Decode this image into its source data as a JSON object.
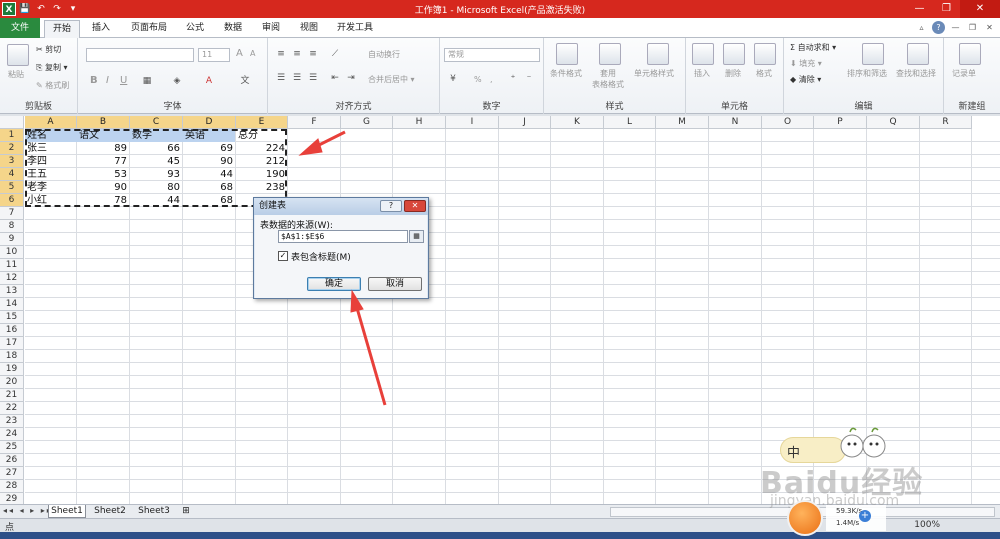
{
  "window": {
    "title": "工作簿1 - Microsoft Excel(产品激活失败)",
    "quick_access": [
      "X",
      "💾",
      "↶",
      "↷",
      "▾"
    ],
    "controls": [
      "—",
      "❐",
      "✕"
    ]
  },
  "tabs": [
    "文件",
    "开始",
    "插入",
    "页面布局",
    "公式",
    "数据",
    "审阅",
    "视图",
    "开发工具"
  ],
  "ribbon": {
    "clipboard": {
      "paste": "粘贴",
      "cut": "剪切",
      "copy": "复制 ▾",
      "format_painter": "格式刷",
      "label": "剪贴板"
    },
    "font": {
      "size": "11",
      "grow": "A",
      "shrink": "A",
      "bold": "B",
      "italic": "I",
      "underline": "U",
      "label": "字体"
    },
    "alignment": {
      "wrap": "自动换行",
      "merge": "合并后居中 ▾",
      "label": "对齐方式"
    },
    "number": {
      "format": "常规",
      "percent": "%",
      "comma": ",",
      "label": "数字"
    },
    "styles": {
      "conditional": "条件格式",
      "table_format": "套用\n表格格式",
      "cell_styles": "单元格样式",
      "label": "样式"
    },
    "cells": {
      "insert": "插入",
      "delete": "删除",
      "format": "格式",
      "label": "单元格"
    },
    "editing": {
      "autosum": "Σ 自动求和 ▾",
      "fill": "填充 ▾",
      "clear": "清除 ▾",
      "sort": "排序和筛选",
      "find": "查找和选择",
      "label": "编辑"
    },
    "new_group": {
      "record": "记录单",
      "label": "新建组"
    }
  },
  "columns": [
    "A",
    "B",
    "C",
    "D",
    "E",
    "F",
    "G",
    "H",
    "I",
    "J",
    "K",
    "L",
    "M",
    "N",
    "O",
    "P",
    "Q",
    "R"
  ],
  "rows": [
    "1",
    "2",
    "3",
    "4",
    "5",
    "6",
    "7",
    "8",
    "9",
    "10",
    "11",
    "12",
    "13",
    "14",
    "15",
    "16",
    "17",
    "18",
    "19",
    "20",
    "21",
    "22",
    "23",
    "24",
    "25",
    "26",
    "27",
    "28",
    "29"
  ],
  "table": {
    "headers": [
      "姓名",
      "语文",
      "数学",
      "英语",
      "总分"
    ],
    "records": [
      [
        "张三",
        "89",
        "66",
        "69",
        "224"
      ],
      [
        "李四",
        "77",
        "45",
        "90",
        "212"
      ],
      [
        "王五",
        "53",
        "93",
        "44",
        "190"
      ],
      [
        "老李",
        "90",
        "80",
        "68",
        "238"
      ],
      [
        "小红",
        "78",
        "44",
        "68",
        ""
      ]
    ]
  },
  "dialog": {
    "title": "创建表",
    "source_label": "表数据的来源(W):",
    "source_value": "$A$1:$E$6",
    "has_headers_label": "表包含标题(M)",
    "has_headers_checked": true,
    "check_mark": "✓",
    "help_glyph": "?",
    "close_glyph": "✕",
    "ref_glyph": "▦",
    "ok": "确定",
    "cancel": "取消"
  },
  "sheets": [
    "Sheet1",
    "Sheet2",
    "Sheet3"
  ],
  "sheet_nav": "◂◂ ◂ ▸ ▸▸",
  "status": {
    "ready": "点",
    "zoom": "100%"
  },
  "overlay": {
    "ime": "中",
    "watermark": "Baidu经验",
    "watermark_sub": "jingyan.baidu.com",
    "speed_up": "59.3K/s",
    "speed_down": "1.4M/s",
    "plus": "+"
  },
  "colors": {
    "title_bar": "#d6281e",
    "file_tab": "#2a8a3e",
    "annotation_arrow": "#e8403a",
    "selection_band": "#bcd3ef"
  }
}
